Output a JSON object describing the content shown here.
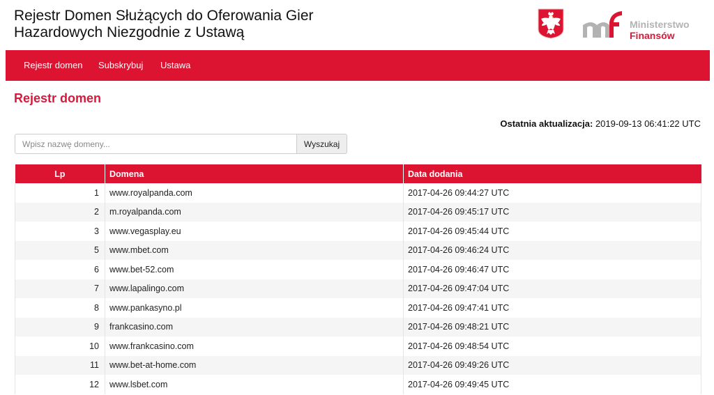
{
  "header": {
    "title": "Rejestr Domen Służących do Oferowania Gier Hazardowych Niezgodnie z Ustawą",
    "ministry_line1": "Ministerstwo",
    "ministry_line2": "Finansów",
    "emblem_icon": "polish-eagle-emblem",
    "logo_icon": "mf-logo"
  },
  "nav": {
    "items": [
      {
        "label": "Rejestr domen"
      },
      {
        "label": "Subskrybuj"
      },
      {
        "label": "Ustawa"
      }
    ]
  },
  "main": {
    "heading": "Rejestr domen",
    "last_update_label": "Ostatnia aktualizacja:",
    "last_update_value": "2019-09-13 06:41:22 UTC"
  },
  "search": {
    "value": "",
    "placeholder": "Wpisz nazwę domeny...",
    "button_label": "Wyszukaj"
  },
  "table": {
    "columns": [
      "Lp",
      "Domena",
      "Data dodania"
    ],
    "rows": [
      {
        "lp": "1",
        "domain": "www.royalpanda.com",
        "date": "2017-04-26 09:44:27 UTC"
      },
      {
        "lp": "2",
        "domain": "m.royalpanda.com",
        "date": "2017-04-26 09:45:17 UTC"
      },
      {
        "lp": "3",
        "domain": "www.vegasplay.eu",
        "date": "2017-04-26 09:45:44 UTC"
      },
      {
        "lp": "5",
        "domain": "www.mbet.com",
        "date": "2017-04-26 09:46:24 UTC"
      },
      {
        "lp": "6",
        "domain": "www.bet-52.com",
        "date": "2017-04-26 09:46:47 UTC"
      },
      {
        "lp": "7",
        "domain": "www.lapalingo.com",
        "date": "2017-04-26 09:47:04 UTC"
      },
      {
        "lp": "8",
        "domain": "www.pankasyno.pl",
        "date": "2017-04-26 09:47:41 UTC"
      },
      {
        "lp": "9",
        "domain": "frankcasino.com",
        "date": "2017-04-26 09:48:21 UTC"
      },
      {
        "lp": "10",
        "domain": "www.frankcasino.com",
        "date": "2017-04-26 09:48:54 UTC"
      },
      {
        "lp": "11",
        "domain": "www.bet-at-home.com",
        "date": "2017-04-26 09:49:26 UTC"
      },
      {
        "lp": "12",
        "domain": "www.lsbet.com",
        "date": "2017-04-26 09:49:45 UTC"
      }
    ]
  },
  "colors": {
    "brand_red": "#dc1431",
    "heading_red": "#d8193b"
  }
}
